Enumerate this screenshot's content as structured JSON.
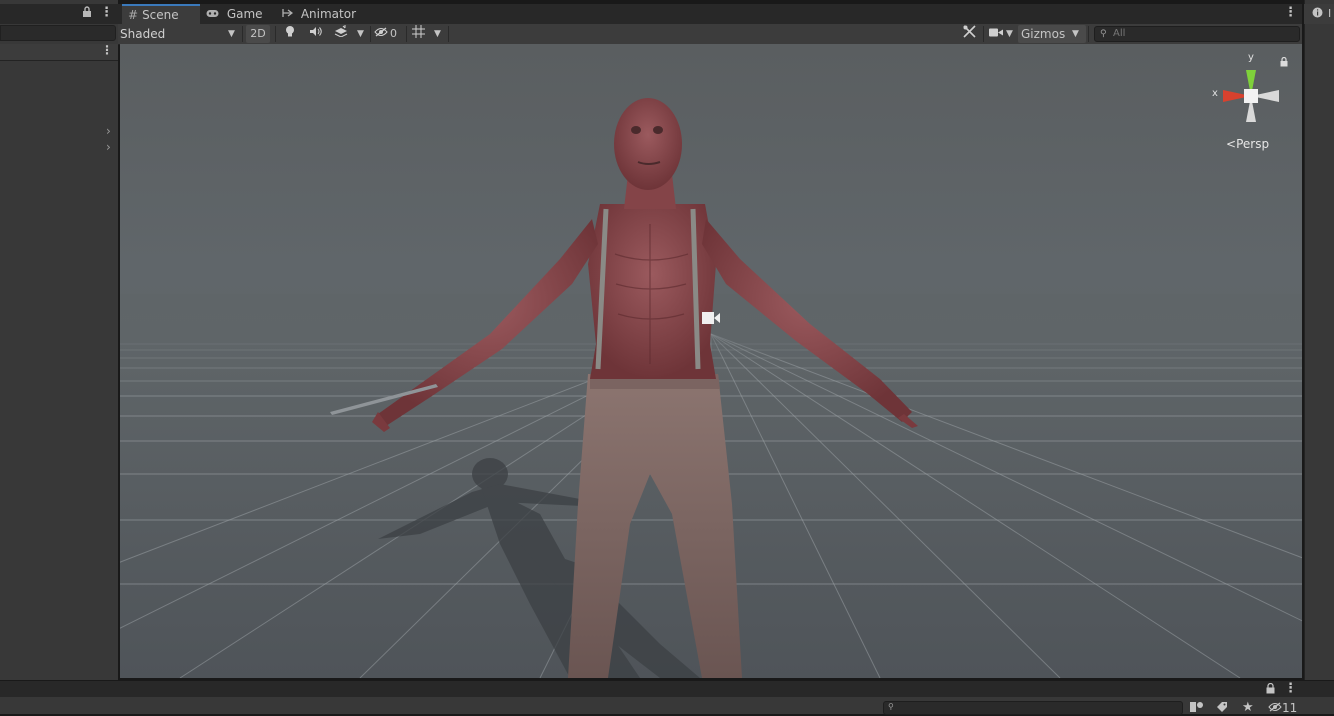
{
  "tabs": [
    {
      "label": "Scene",
      "icon": "grid-hash-icon",
      "active": true
    },
    {
      "label": "Game",
      "icon": "gamepad-icon",
      "active": false
    },
    {
      "label": "Animator",
      "icon": "animator-icon",
      "active": false
    }
  ],
  "toolbar": {
    "shading_mode": "Shaded",
    "twod_label": "2D",
    "hidden_count": "0",
    "gizmos_label": "Gizmos",
    "search_placeholder": "All"
  },
  "viewport": {
    "gizmo_axes": {
      "x": "x",
      "y": "y"
    },
    "projection_label": "Persp",
    "character": "zombie"
  },
  "bottom": {
    "hidden_count": "11"
  },
  "inspector": {
    "tab_label": "I"
  },
  "colors": {
    "tab_active_accent": "#3a79bb",
    "axis_x": "#d8412e",
    "axis_y": "#7fd13b",
    "viewport_sky": "#5f6568"
  }
}
